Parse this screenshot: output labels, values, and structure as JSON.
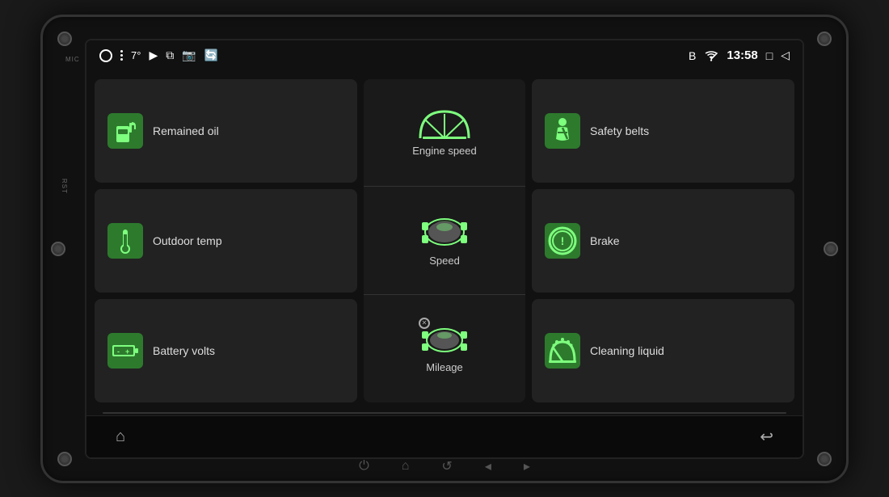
{
  "device": {
    "mic_label": "MIC",
    "rst_label": "RST"
  },
  "status_bar": {
    "temp": "7°",
    "time": "13:58",
    "icons": [
      "circle",
      "menu",
      "youtube",
      "camera1",
      "camera2",
      "camera3",
      "bluetooth",
      "wifi",
      "square",
      "back"
    ]
  },
  "cards": {
    "remained_oil": {
      "label": "Remained oil",
      "icon": "fuel"
    },
    "outdoor_temp": {
      "label": "Outdoor temp",
      "icon": "thermometer"
    },
    "battery_volts": {
      "label": "Battery volts",
      "icon": "battery"
    },
    "safety_belts": {
      "label": "Safety belts",
      "icon": "seatbelt"
    },
    "brake": {
      "label": "Brake",
      "icon": "brake"
    },
    "cleaning_liquid": {
      "label": "Cleaning liquid",
      "icon": "washer"
    }
  },
  "center_panels": {
    "engine_speed": {
      "label": "Engine speed",
      "icon": "speedometer"
    },
    "speed": {
      "label": "Speed",
      "icon": "car"
    },
    "mileage": {
      "label": "Mileage",
      "icon": "car_distance"
    }
  },
  "bottom_bar": {
    "home_icon": "⌂",
    "back_icon": "↩"
  },
  "physical_buttons": {
    "power": "⏻",
    "home": "⌂",
    "back": "↺",
    "vol_down": "◂",
    "vol_up": "▸"
  }
}
